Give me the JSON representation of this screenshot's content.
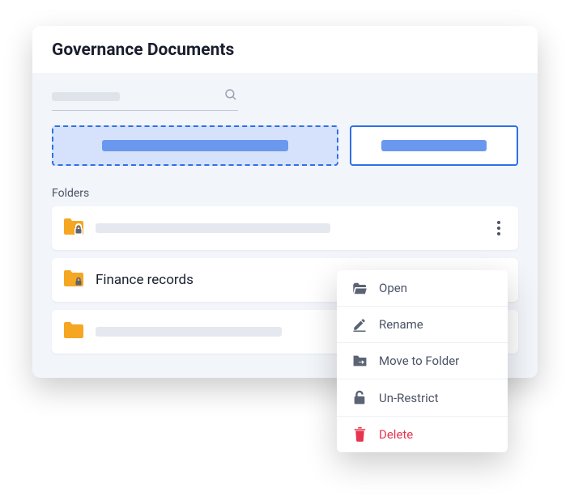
{
  "header": {
    "title": "Governance Documents"
  },
  "search": {
    "placeholder": ""
  },
  "section": {
    "label": "Folders"
  },
  "folders": {
    "items": [
      {
        "name": "",
        "locked": true,
        "placeholder_width": 290
      },
      {
        "name": "Finance records",
        "locked": true,
        "active": true
      },
      {
        "name": "",
        "locked": false,
        "placeholder_width": 230
      }
    ]
  },
  "menu": {
    "open": "Open",
    "rename": "Rename",
    "move": "Move to Folder",
    "unrestrict": "Un-Restrict",
    "delete": "Delete"
  },
  "colors": {
    "folder": "#f5a623",
    "accent": "#2f6fe8",
    "danger": "#e7344f"
  }
}
